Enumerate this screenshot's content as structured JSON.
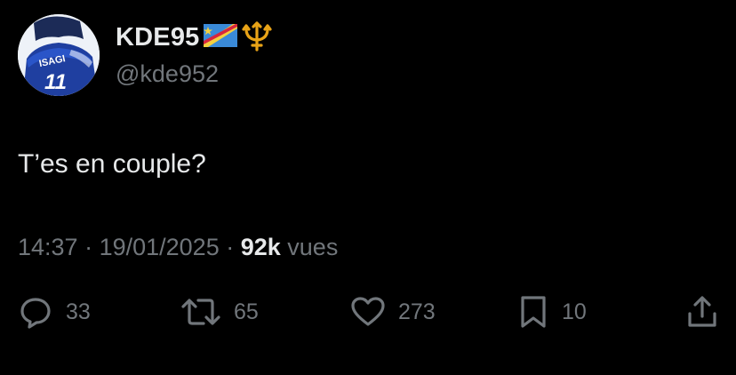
{
  "user": {
    "display_name": "KDE95",
    "handle": "@kde952",
    "avatar_text": "ISAGI",
    "avatar_number": "11",
    "emojis": [
      "dr-congo-flag-icon",
      "trident-icon"
    ]
  },
  "tweet": {
    "text": "T’es en couple?"
  },
  "meta": {
    "time": "14:37",
    "separator1": " · ",
    "date": "19/01/2025",
    "separator2": " · ",
    "views_count": "92k",
    "views_label": " vues"
  },
  "actions": {
    "replies": "33",
    "retweets": "65",
    "likes": "273",
    "bookmarks": "10"
  },
  "colors": {
    "background": "#000000",
    "primary_text": "#e7e9ea",
    "secondary_text": "#71767b",
    "trident_gold": "#e8a317",
    "flag_blue": "#3a8ad8",
    "flag_red": "#d7263d",
    "flag_yellow": "#f4d03f"
  }
}
